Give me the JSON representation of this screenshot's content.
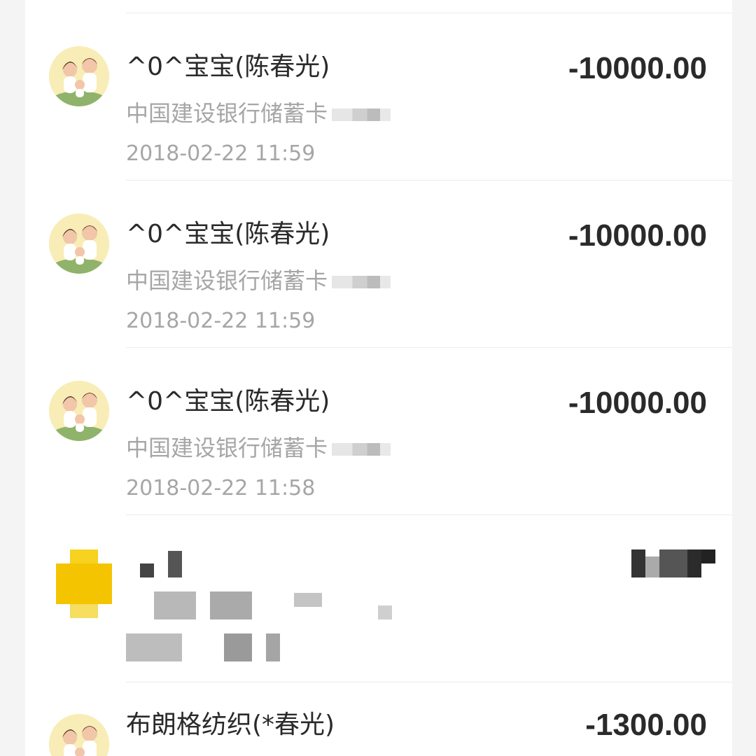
{
  "transactions": [
    {
      "title": "^0^宝宝(陈春光)",
      "subtitle": "中国建设银行储蓄卡",
      "time": "2018-02-22 11:59",
      "amount": "-10000.00",
      "avatar_icon": "couple-avatar-icon"
    },
    {
      "title": "^0^宝宝(陈春光)",
      "subtitle": "中国建设银行储蓄卡",
      "time": "2018-02-22 11:59",
      "amount": "-10000.00",
      "avatar_icon": "couple-avatar-icon"
    },
    {
      "title": "^0^宝宝(陈春光)",
      "subtitle": "中国建设银行储蓄卡",
      "time": "2018-02-22 11:58",
      "amount": "-10000.00",
      "avatar_icon": "couple-avatar-icon"
    },
    {
      "avatar_icon": "yellow-merchant-icon",
      "redacted": true
    },
    {
      "title": "布朗格纺织(*春光)",
      "amount": "-1300.00",
      "avatar_icon": "couple-avatar-icon"
    }
  ],
  "colors": {
    "background": "#f4f4f4",
    "card": "#ffffff",
    "primary_text": "#2a2a2a",
    "secondary_text": "#a6a6a6",
    "avatar_bg": "#f7e8a6",
    "merchant_icon": "#f5c400"
  }
}
